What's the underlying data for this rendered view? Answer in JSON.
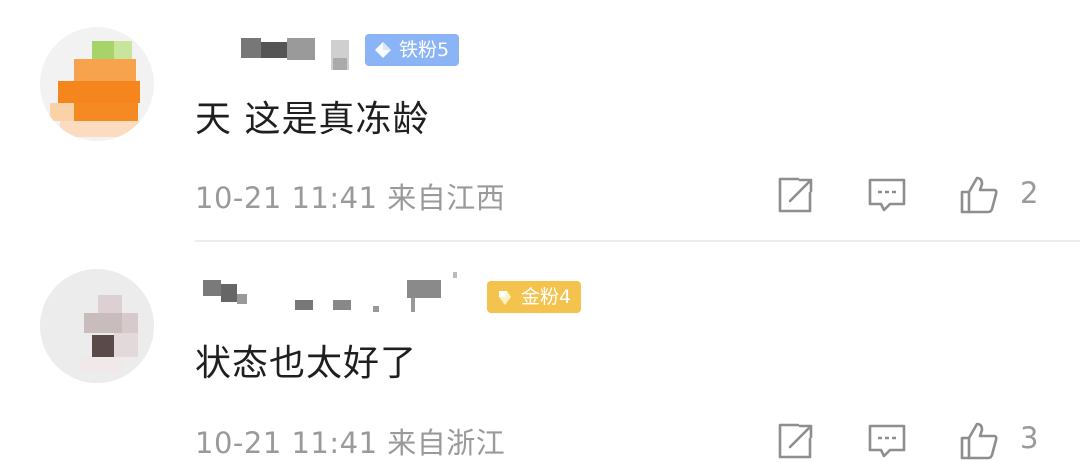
{
  "comments": [
    {
      "badge": {
        "label": "铁粉5",
        "color": "#8bb4f6",
        "icon": "diamond-icon"
      },
      "text": "天 这是真冻龄",
      "time": "10-21 11:41",
      "location": "来自江西",
      "likes": "2"
    },
    {
      "badge": {
        "label": "金粉4",
        "color": "#f3c34e",
        "icon": "gold-gem-icon"
      },
      "text": "状态也太好了",
      "time": "10-21 11:41",
      "location": "来自浙江",
      "likes": "3"
    }
  ],
  "icons": {
    "share": "share-icon",
    "reply": "comment-icon",
    "like": "thumbs-up-icon"
  }
}
